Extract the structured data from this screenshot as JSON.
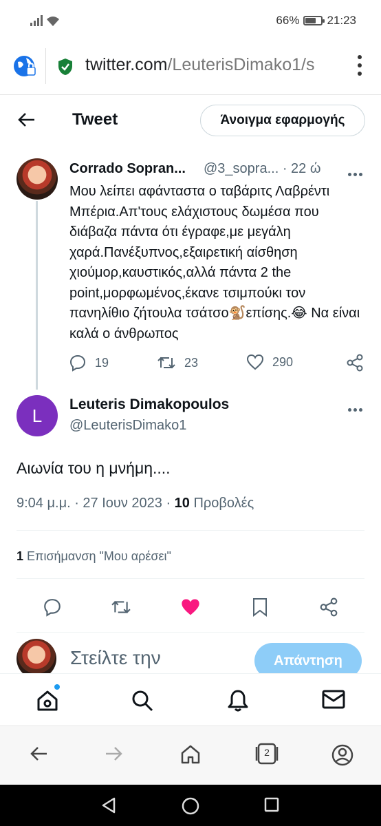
{
  "status_bar": {
    "battery": "66%",
    "battery_level": 0.66,
    "time": "21:23"
  },
  "browser": {
    "url_host": "twitter.com",
    "url_path": "/LeuterisDimako1/s"
  },
  "header": {
    "title": "Tweet",
    "open_app_label": "Άνοιγμα εφαρμογής"
  },
  "parent_tweet": {
    "name": "Corrado Sopran...",
    "handle": "@3_sopra...",
    "time": "· 22 ώ",
    "text": "Μου λείπει αφάνταστα ο ταβάριτς Λαβρέντι Μπέρια.Απ'τους ελάχιστους δωμέσα που διάβαζα πάντα ότι έγραφε,με μεγάλη χαρά.Πανέξυπνος,εξαιρετική αίσθηση χιούμορ,καυστικός,αλλά πάντα 2 the point,μορφωμένος,έκανε τσιμπούκι τον πανηλίθιο ζήτουλα τσάτσο🐒επίσης.😂 Να είναι καλά ο άνθρωπος",
    "replies": "19",
    "retweets": "23",
    "likes": "290"
  },
  "main_tweet": {
    "avatar_letter": "L",
    "avatar_color": "#7b2fbe",
    "name": "Leuteris Dimakopoulos",
    "handle": "@LeuterisDimako1",
    "text": "Αιωνία του η μνήμη....",
    "date": "9:04 μ.μ. · 27 Ιουν 2023 · ",
    "views_count": "10",
    "views_label": " Προβολές",
    "likes_count": "1",
    "likes_label": " Επισήμανση \"Μου αρέσει\"",
    "liked": true,
    "like_color": "#f91880"
  },
  "reply_box": {
    "placeholder": "Στείλτε την",
    "button_label": "Απάντηση"
  },
  "browser_nav": {
    "tabs_count": "2"
  },
  "colors": {
    "accent": "#1d9bf0",
    "secure": "#188038"
  }
}
